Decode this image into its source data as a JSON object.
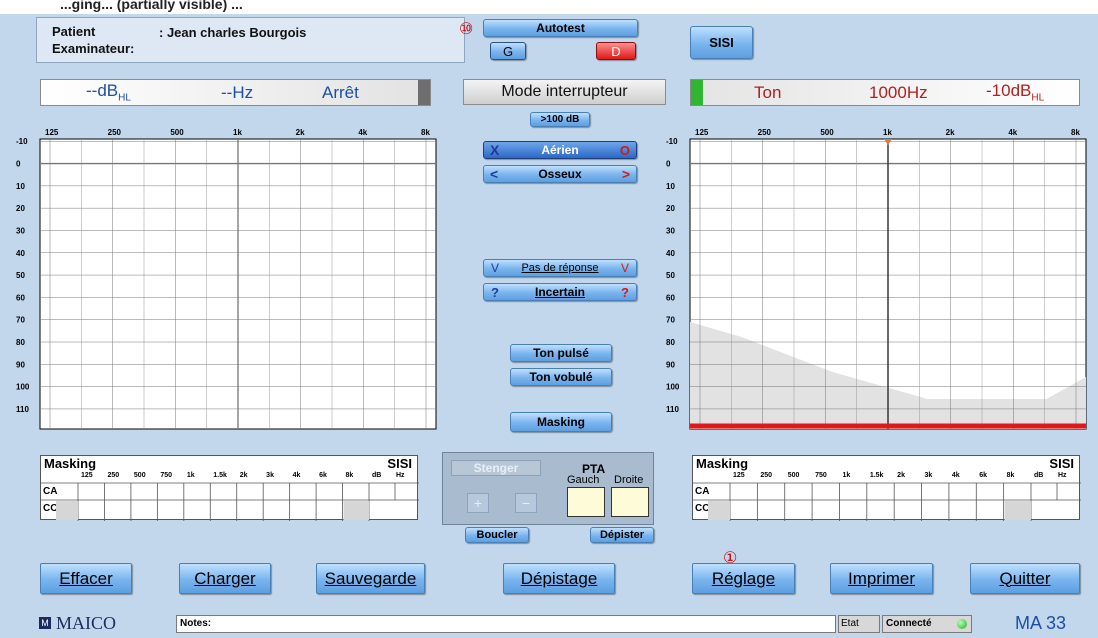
{
  "header_strip": "...ging... (partially visible) ...",
  "patient": {
    "patient_label": "Patient",
    "patient_value": ": Jean charles Bourgois",
    "examiner_label": "Examinateur:",
    "examiner_value": ""
  },
  "top_buttons": {
    "autotest": "Autotest",
    "autotest_badge": "⑩",
    "left_ear": "G",
    "right_ear": "D",
    "sisi": "SISI"
  },
  "left_readout": {
    "level": "--dB",
    "level_sub": "HL",
    "freq": "--Hz",
    "state": "Arrêt"
  },
  "right_readout": {
    "mode": "Ton",
    "freq": "1000Hz",
    "level": "-10dB",
    "level_sub": "HL"
  },
  "mode_label": "Mode interrupteur",
  "over100": ">100 dB",
  "conduction": {
    "aerien": "Aérien",
    "aerien_left": "X",
    "aerien_right": "O",
    "osseux": "Osseux",
    "osseux_left": "<",
    "osseux_right": ">"
  },
  "response": {
    "pas": "Pas de réponse",
    "pas_left": "V",
    "pas_right": "V",
    "incertain": "Incertain",
    "inc_left": "?",
    "inc_right": "?"
  },
  "tone": {
    "pulse": "Ton pulsé",
    "vobule": "Ton vobulé",
    "masking": "Masking"
  },
  "audiogram": {
    "freq_labels": [
      "125",
      "250",
      "500",
      "1k",
      "2k",
      "4k",
      "8k"
    ],
    "level_labels": [
      "-10",
      "0",
      "10",
      "20",
      "30",
      "40",
      "50",
      "60",
      "70",
      "80",
      "90",
      "100",
      "110"
    ]
  },
  "masking_table": {
    "title": "Masking",
    "sisi": "SISI",
    "freqs": [
      "125",
      "250",
      "500",
      "750",
      "1k",
      "1.5k",
      "2k",
      "3k",
      "4k",
      "6k",
      "8k"
    ],
    "sisi_cols": [
      "dB",
      "Hz"
    ],
    "rows": [
      "CA",
      "CO"
    ]
  },
  "pta": {
    "stenger": "Stenger",
    "title": "PTA",
    "gauche": "Gauch",
    "droite": "Droite",
    "plus": "+",
    "minus": "−"
  },
  "loop": {
    "boucler": "Boucler",
    "depister": "Dépister"
  },
  "bottom_buttons": {
    "effacer": "Effacer",
    "charger": "Charger",
    "sauvegarde": "Sauvegarde",
    "depistage": "Dépistage",
    "reglage": "Réglage",
    "reglage_badge": "①",
    "imprimer": "Imprimer",
    "quitter": "Quitter"
  },
  "status_bar": {
    "brand": "MAICO",
    "notes_label": "Notes:",
    "etat_label": "Etat",
    "status": "Connecté",
    "model": "MA 33"
  },
  "colors": {
    "accent_blue": "#1c4fa3",
    "accent_red": "#b02020",
    "status_green": "#37c237",
    "background": "#c2d7ec"
  }
}
